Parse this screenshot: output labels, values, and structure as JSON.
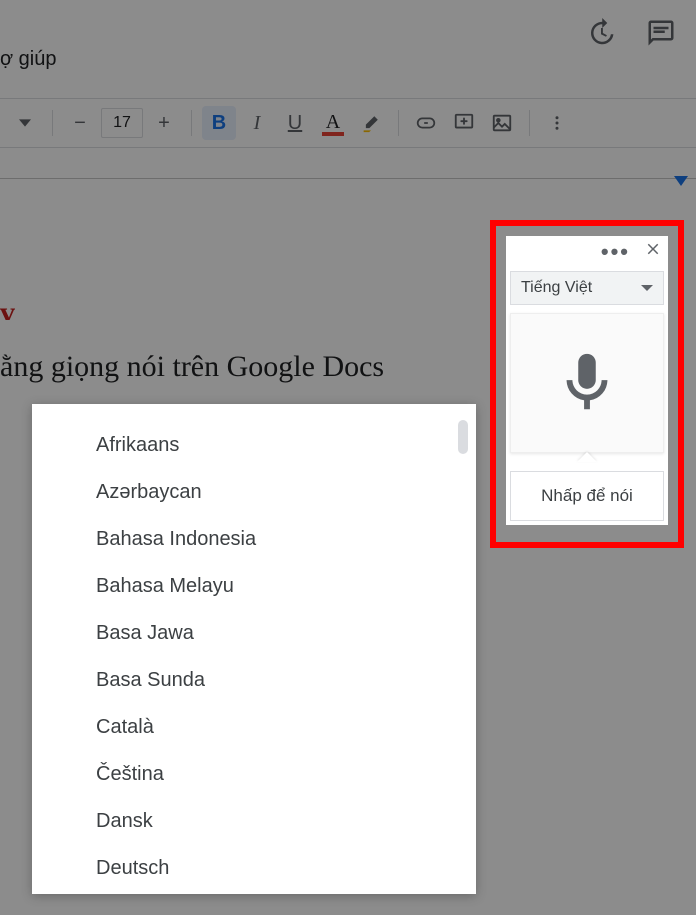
{
  "menu": {
    "help": "ợ giúp"
  },
  "toolbar": {
    "font_size": "17"
  },
  "doc": {
    "heading": "ằng giọng nói trên Google Docs"
  },
  "voice": {
    "selected_language": "Tiếng Việt",
    "prompt": "Nhấp để nói"
  },
  "languages": [
    "Afrikaans",
    "Azərbaycan",
    "Bahasa Indonesia",
    "Bahasa Melayu",
    "Basa Jawa",
    "Basa Sunda",
    "Català",
    "Čeština",
    "Dansk",
    "Deutsch"
  ]
}
